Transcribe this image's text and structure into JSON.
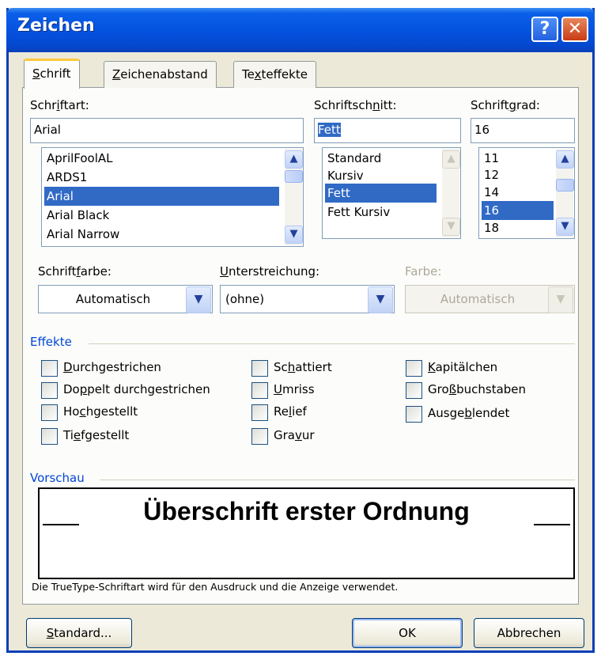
{
  "window": {
    "title": "Zeichen",
    "help": "?",
    "close": "✕"
  },
  "tabs": [
    {
      "pre": "",
      "ul": "S",
      "post": "chrift"
    },
    {
      "pre": "",
      "ul": "Z",
      "post": "eichenabstand"
    },
    {
      "pre": "Te",
      "ul": "x",
      "post": "teffekte"
    }
  ],
  "font": {
    "label": {
      "pre": "Schr",
      "ul": "i",
      "post": "ftart:"
    },
    "value": "Arial",
    "items": [
      "AprilFoolAL",
      "ARDS1",
      "Arial",
      "Arial Black",
      "Arial Narrow"
    ],
    "selected_index": 2
  },
  "style": {
    "label": {
      "pre": "Schriftsch",
      "ul": "n",
      "post": "itt:"
    },
    "value": "Fett",
    "items": [
      "Standard",
      "Kursiv",
      "Fett",
      "Fett Kursiv"
    ],
    "selected_index": 2
  },
  "size": {
    "label": {
      "pre": "Schrift",
      "ul": "g",
      "post": "rad:"
    },
    "value": "16",
    "items": [
      "11",
      "12",
      "14",
      "16",
      "18"
    ],
    "selected_index": 3
  },
  "color": {
    "label": {
      "pre": "Schrift",
      "ul": "f",
      "post": "arbe:"
    },
    "value": "Automatisch"
  },
  "underline": {
    "label": {
      "pre": "",
      "ul": "U",
      "post": "nterstreichung:"
    },
    "value": "(ohne)"
  },
  "underline_color": {
    "label": "Farbe:",
    "value": "Automatisch"
  },
  "effects": {
    "title": "Effekte",
    "col1": [
      {
        "pre": "",
        "ul": "D",
        "post": "urchgestrichen",
        "checked": false
      },
      {
        "pre": "Do",
        "ul": "p",
        "post": "pelt durchgestrichen",
        "checked": false
      },
      {
        "pre": "Ho",
        "ul": "c",
        "post": "hgestellt",
        "checked": false
      },
      {
        "pre": "Ti",
        "ul": "e",
        "post": "fgestellt",
        "checked": false
      }
    ],
    "col2": [
      {
        "pre": "Sc",
        "ul": "h",
        "post": "attiert",
        "checked": false
      },
      {
        "pre": "",
        "ul": "U",
        "post": "mriss",
        "checked": false
      },
      {
        "pre": "Re",
        "ul": "l",
        "post": "ief",
        "checked": false
      },
      {
        "pre": "Gra",
        "ul": "v",
        "post": "ur",
        "checked": false
      }
    ],
    "col3": [
      {
        "pre": "",
        "ul": "K",
        "post": "apitälchen",
        "checked": false
      },
      {
        "pre": "Gro",
        "ul": "ß",
        "post": "buchstaben",
        "checked": false
      },
      {
        "pre": "Ausge",
        "ul": "b",
        "post": "lendet",
        "checked": false
      }
    ]
  },
  "preview": {
    "title": "Vorschau",
    "text": "Überschrift erster Ordnung",
    "note": "Die TrueType-Schriftart wird für den Ausdruck und die Anzeige verwendet."
  },
  "buttons": {
    "default": {
      "pre": "",
      "ul": "S",
      "post": "tandard..."
    },
    "ok": "OK",
    "cancel": "Abbrechen"
  },
  "colors": {
    "titlebar": "#0553e0",
    "selection": "#316ac5",
    "group_title": "#0046d5",
    "dialog_bg": "#ece9d8"
  },
  "icons": {
    "scroll_up": "▲",
    "scroll_down": "▼",
    "combo": "▼"
  }
}
